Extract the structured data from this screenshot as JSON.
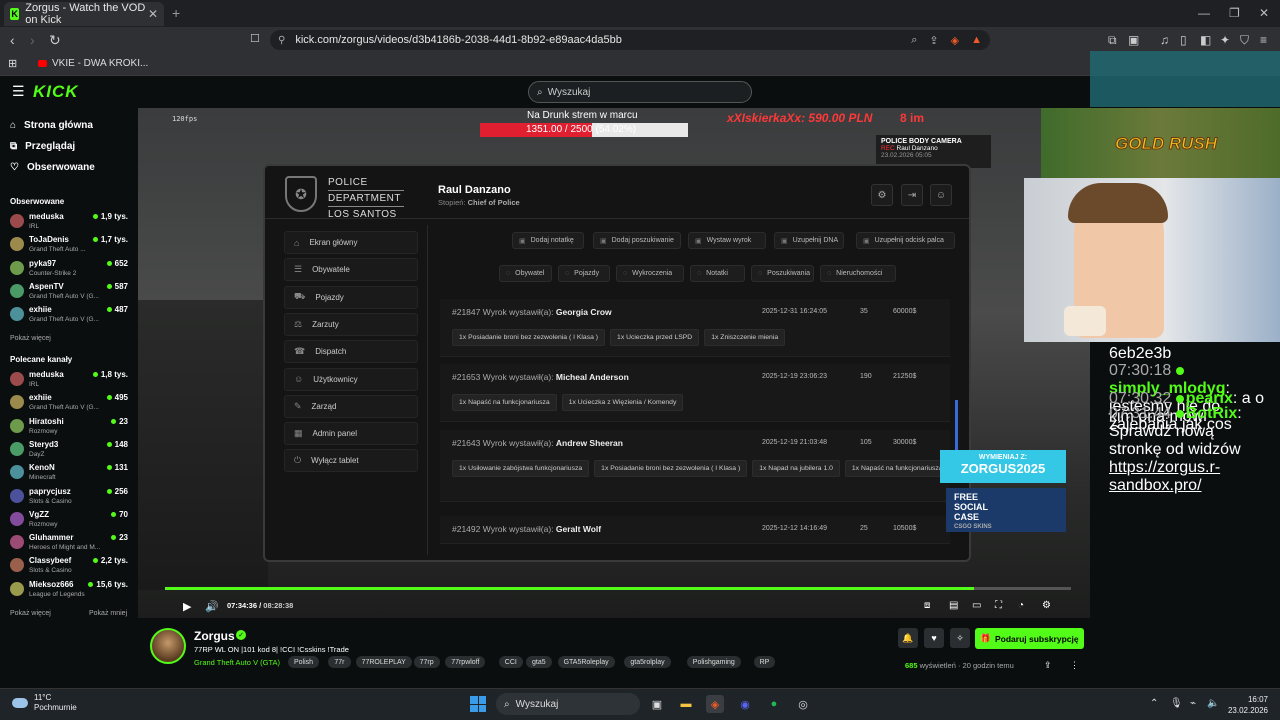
{
  "browser": {
    "tab_title": "Zorgus - Watch the VOD on Kick",
    "url": "kick.com/zorgus/videos/d3b4186b-2038-44d1-8b92-e89aac4da5bb",
    "bookmark": "VKIE - DWA KROKI..."
  },
  "kick": {
    "logo": "KICK",
    "search_placeholder": "Wyszukaj"
  },
  "sidebar": {
    "nav": [
      {
        "label": "Strona główna",
        "icon": "home-icon"
      },
      {
        "label": "Przeglądaj",
        "icon": "browse-icon"
      },
      {
        "label": "Obserwowane",
        "icon": "heart-icon"
      }
    ],
    "followed_title": "Obserwowane",
    "followed": [
      {
        "name": "meduska",
        "game": "IRL",
        "viewers": "1,9 tys."
      },
      {
        "name": "ToJaDenis",
        "game": "Grand Theft Auto ...",
        "viewers": "1,7 tys."
      },
      {
        "name": "pyka97",
        "game": "Counter-Strike 2",
        "viewers": "652"
      },
      {
        "name": "AspenTV",
        "game": "Grand Theft Auto V (G...",
        "viewers": "587"
      },
      {
        "name": "exhiie",
        "game": "Grand Theft Auto V (G...",
        "viewers": "487"
      }
    ],
    "show_more_1": "Pokaż więcej",
    "recommended_title": "Polecane kanały",
    "recommended": [
      {
        "name": "meduska",
        "game": "IRL",
        "viewers": "1,8 tys."
      },
      {
        "name": "exhiie",
        "game": "Grand Theft Auto V (G...",
        "viewers": "495"
      },
      {
        "name": "Hiratoshi",
        "game": "Rozmowy",
        "viewers": "23"
      },
      {
        "name": "Steryd3",
        "game": "DayZ",
        "viewers": "148"
      },
      {
        "name": "KenoN",
        "game": "Minecraft",
        "viewers": "131"
      },
      {
        "name": "paprycjusz",
        "game": "Slots & Casino",
        "viewers": "256"
      },
      {
        "name": "VgZZ",
        "game": "Rozmowy",
        "viewers": "70"
      },
      {
        "name": "Gluhammer",
        "game": "Heroes of Might and M...",
        "viewers": "23"
      },
      {
        "name": "Classybeef",
        "game": "Slots & Casino",
        "viewers": "2,2 tys."
      },
      {
        "name": "Mieksoz666",
        "game": "League of Legends",
        "viewers": "15,6 tys."
      }
    ],
    "show_more_2": "Pokaż więcej",
    "show_less": "Pokaż mniej"
  },
  "video": {
    "fps": "120fps",
    "goal_title": "Na Drunk strem w marcu",
    "goal_value": "1351.00 / 2500 (54.02%)",
    "goal_percent": 54.02,
    "donor": "xXIskierkaXx: 590.00 PLN",
    "donor_extra": "8 im",
    "bodycam": {
      "title": "POLICE BODY CAMERA",
      "rec": "REC",
      "name": "Raul Danzano",
      "date": "23.02.2026 05:05"
    },
    "time_current": "07:34:36",
    "time_total": "08:28:38",
    "progress": 0.893
  },
  "tablet": {
    "dept_line1": "POLICE",
    "dept_line2": "DEPARTMENT",
    "dept_line3": "LOS SANTOS",
    "officer": "Raul Danzano",
    "rank_label": "Stopień:",
    "rank": "Chief of Police",
    "nav": [
      "Ekran główny",
      "Obywatele",
      "Pojazdy",
      "Zarzuty",
      "Dispatch",
      "Użytkownicy",
      "Zarząd",
      "Admin panel",
      "Wyłącz tablet"
    ],
    "actions": [
      "Dodaj notatkę",
      "Dodaj poszukiwanie",
      "Wystaw wyrok",
      "Uzupełnij DNA",
      "Uzupełnij odcisk palca"
    ],
    "filters": [
      "Obywatel",
      "Pojazdy",
      "Wykroczenia",
      "Notatki",
      "Poszukiwania",
      "Nieruchomości"
    ],
    "records": [
      {
        "id": "#21847",
        "label": "Wyrok wystawił(a):",
        "officer": "Georgia Crow",
        "date": "2025-12-31 16:24:05",
        "count": "35",
        "amount": "60000$",
        "charges": [
          "1x Posiadanie broni bez zezwolenia ( I Klasa )",
          "1x Ucieczka przed LSPD",
          "1x Zniszczenie mienia"
        ]
      },
      {
        "id": "#21653",
        "label": "Wyrok wystawił(a):",
        "officer": "Micheal Anderson",
        "date": "2025-12-19 23:06:23",
        "count": "190",
        "amount": "21250$",
        "charges": [
          "1x Napaść na funkcjonariusza",
          "1x Ucieczka z Więzienia / Komendy"
        ]
      },
      {
        "id": "#21643",
        "label": "Wyrok wystawił(a):",
        "officer": "Andrew Sheeran",
        "date": "2025-12-19 21:03:48",
        "count": "105",
        "amount": "30000$",
        "charges": [
          "1x Usiłowanie zabójstwa funkcjonariusza",
          "1x Posiadanie broni bez zezwolenia ( I Klasa )",
          "1x Napad na jubilera 1.0",
          "1x Napaść na funkcjonariusza"
        ]
      },
      {
        "id": "#21492",
        "label": "Wyrok wystawił(a):",
        "officer": "Geralt Wolf",
        "date": "2025-12-12 14:16:49",
        "count": "25",
        "amount": "10500$",
        "charges": []
      }
    ]
  },
  "overlays": {
    "gold_rush": "GOLD RUSH",
    "promo_label": "WYMIENIAJ Z:",
    "promo_code": "ZORGUS2025",
    "skins_line1": "FREE",
    "skins_line2": "SOCIAL",
    "skins_line3": "CASE",
    "skins_sub": "CSGO SKINS"
  },
  "chat": [
    {
      "time": "",
      "user": "",
      "text": "6eb2e3b"
    },
    {
      "time": "07:30:18",
      "user": "simply_mlodyg",
      "text": "jestesmy nie do zajebania jak cos"
    },
    {
      "time": "07:30:32",
      "user": "pearix",
      "text": "a o kim ona mowi"
    },
    {
      "time": "07:31:44",
      "user": "BotRix",
      "text": "Sprawdź nową stronkę od widzów ",
      "link": "https://zorgus.r-sandbox.pro/"
    }
  ],
  "streamer": {
    "name": "Zorgus",
    "title": "77RP WL ON |101 kod 8|  !CCI !Csskins !Trade",
    "game": "Grand Theft Auto V (GTA)",
    "tags": [
      "Polish",
      "77r",
      "77ROLEPLAY",
      "77rp",
      "77rpwloff",
      "CCI",
      "gta5",
      "GTA5Roleplay",
      "gta5rolplay",
      "Polishgaming",
      "RP"
    ],
    "subscribe": "Podaruj subskrypcję",
    "views": "685",
    "views_label": "wyświetleń",
    "ago": "20 godzin temu"
  },
  "taskbar": {
    "temp": "11°C",
    "weather": "Pochmurnie",
    "search": "Wyszukaj",
    "time": "16:07",
    "date": "23.02.2026"
  }
}
